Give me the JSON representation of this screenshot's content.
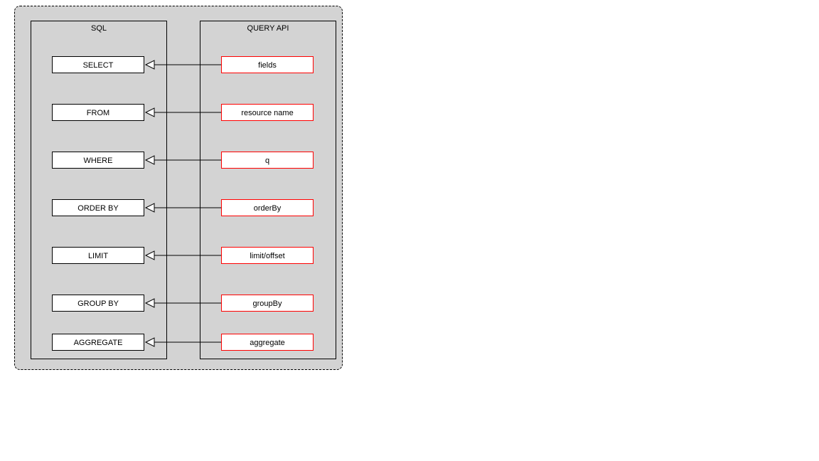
{
  "columns": {
    "left_title": "SQL",
    "right_title": "QUERY API"
  },
  "rows": [
    {
      "sql": "SELECT",
      "api": "fields"
    },
    {
      "sql": "FROM",
      "api": "resource name"
    },
    {
      "sql": "WHERE",
      "api": "q"
    },
    {
      "sql": "ORDER BY",
      "api": "orderBy"
    },
    {
      "sql": "LIMIT",
      "api": "limit/offset"
    },
    {
      "sql": "GROUP BY",
      "api": "groupBy"
    },
    {
      "sql": "AGGREGATE",
      "api": "aggregate"
    }
  ]
}
